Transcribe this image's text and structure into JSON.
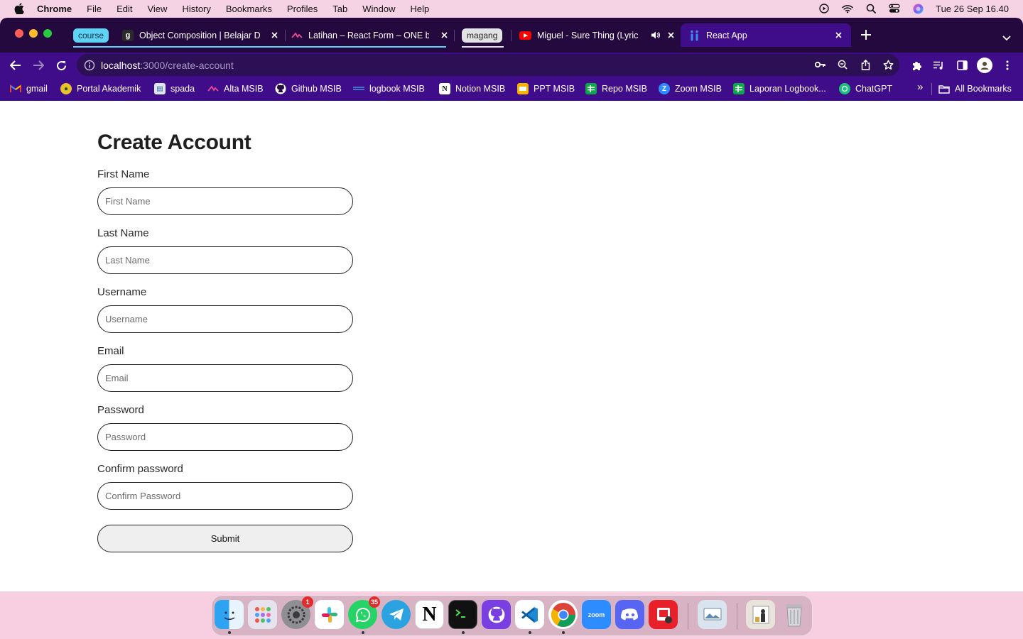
{
  "menubar": {
    "app_name": "Chrome",
    "menus": [
      "File",
      "Edit",
      "View",
      "History",
      "Bookmarks",
      "Profiles",
      "Tab",
      "Window",
      "Help"
    ],
    "clock": "Tue 26 Sep  16.40"
  },
  "tabs": {
    "group_course": "course",
    "tab1_title": "Object Composition | Belajar D",
    "tab2_title": "Latihan – React Form – ONE b",
    "group_magang": "magang",
    "tab3_title": "Miguel - Sure Thing (Lyric",
    "tab4_title": "React App"
  },
  "address_bar": {
    "host": "localhost",
    "path": ":3000/create-account"
  },
  "bookmarks": [
    "gmail",
    "Portal Akademik",
    "spada",
    "Alta MSIB",
    "Github MSIB",
    "logbook MSIB",
    "Notion MSIB",
    "PPT MSIB",
    "Repo MSIB",
    "Zoom MSIB",
    "Laporan Logbook...",
    "ChatGPT"
  ],
  "bookmarks_overflow": "»",
  "all_bookmarks": "All Bookmarks",
  "form": {
    "title": "Create Account",
    "fields": [
      {
        "label": "First Name",
        "placeholder": "First Name"
      },
      {
        "label": "Last Name",
        "placeholder": "Last Name"
      },
      {
        "label": "Username",
        "placeholder": "Username"
      },
      {
        "label": "Email",
        "placeholder": "Email"
      },
      {
        "label": "Password",
        "placeholder": "Password"
      },
      {
        "label": "Confirm password",
        "placeholder": "Confirm Password"
      }
    ],
    "submit_label": "Submit"
  },
  "dock": {
    "badges": {
      "settings": "1",
      "whatsapp": "35"
    },
    "zoom_label": "zoom"
  },
  "colors": {
    "tabstrip": "#24093e",
    "toolbar": "#3f0d8a",
    "group_course": "#5fd3f3",
    "group_magang": "#e3e3e3"
  }
}
